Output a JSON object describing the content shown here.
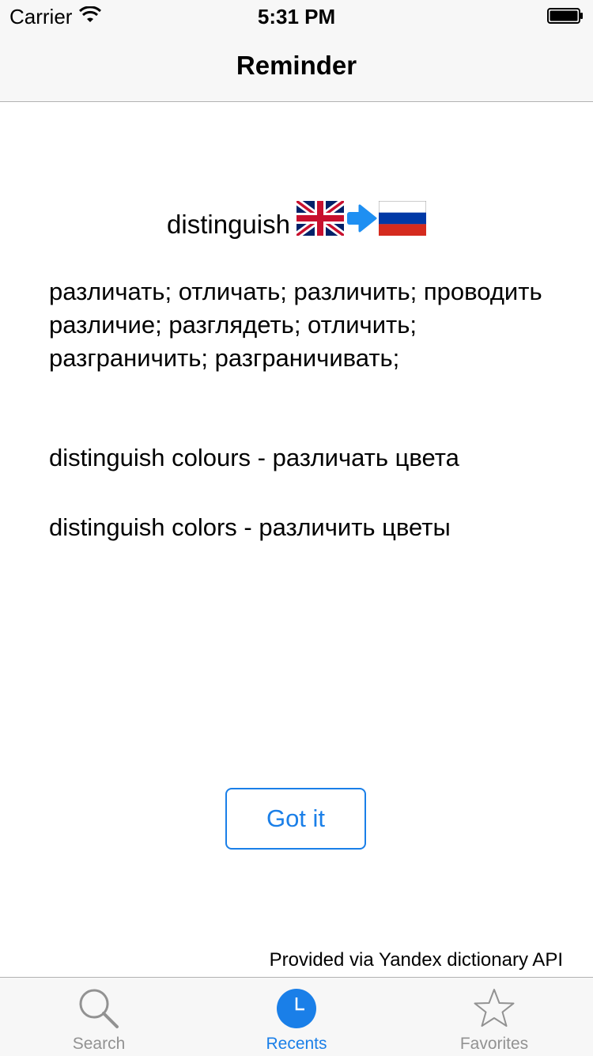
{
  "status_bar": {
    "carrier": "Carrier",
    "time": "5:31 PM"
  },
  "nav": {
    "title": "Reminder"
  },
  "word": {
    "text": "distinguish",
    "from_flag": "uk-flag-icon",
    "to_flag": "russia-flag-icon",
    "arrow": "arrow-right-icon"
  },
  "translations": "различать; отличать; различить; проводить различие; разглядеть; отличить; разграничить; разграничивать;",
  "examples": [
    "distinguish colours - различать цвета",
    "distinguish colors - различить цветы"
  ],
  "button": {
    "label": "Got it"
  },
  "footer": {
    "attribution": "Provided via Yandex dictionary API"
  },
  "tabs": [
    {
      "label": "Search",
      "icon": "search-icon",
      "active": false
    },
    {
      "label": "Recents",
      "icon": "clock-icon",
      "active": true
    },
    {
      "label": "Favorites",
      "icon": "star-icon",
      "active": false
    }
  ],
  "colors": {
    "accent": "#1a7fe8",
    "inactive": "#929292",
    "bar": "#f7f7f7"
  }
}
